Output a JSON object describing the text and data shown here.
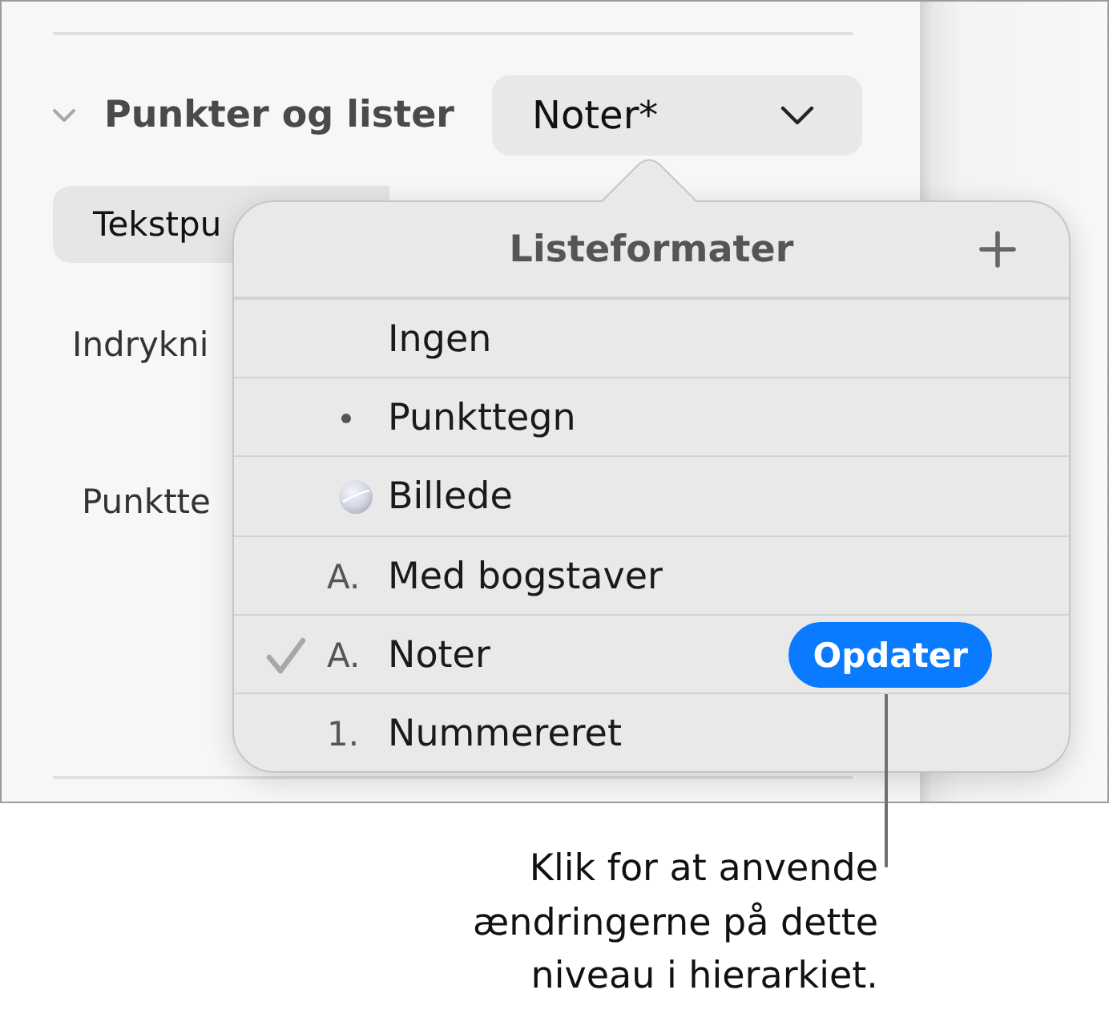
{
  "inspector": {
    "section": {
      "title": "Punkter og lister",
      "expanded": true,
      "style_popup": "Noter*"
    },
    "bullet_type_popup": "Tekstpu",
    "field_labels": [
      "Indrykni",
      "Punktte"
    ]
  },
  "popover": {
    "title": "Listeformater",
    "items": [
      {
        "label": "Ingen",
        "kind": "none",
        "selected": false
      },
      {
        "label": "Punkttegn",
        "kind": "bullet",
        "selected": false
      },
      {
        "label": "Billede",
        "kind": "image",
        "selected": false
      },
      {
        "label": "Med bogstaver",
        "kind": "label",
        "marker": "A.",
        "selected": false
      },
      {
        "label": "Noter",
        "kind": "label",
        "marker": "A.",
        "selected": true,
        "update_button": "Opdater"
      },
      {
        "label": "Nummereret",
        "kind": "label",
        "marker": "1.",
        "selected": false
      }
    ]
  },
  "callout": {
    "text": "Klik for at anvende ændringerne på dette niveau i hierarkiet."
  }
}
